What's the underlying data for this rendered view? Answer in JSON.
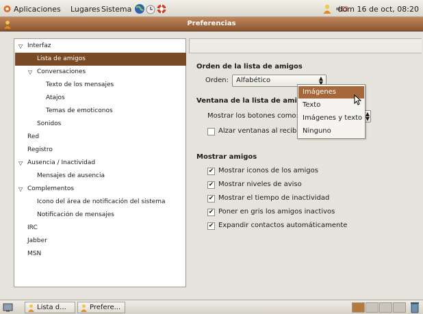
{
  "top_panel": {
    "menus": [
      "Aplicaciones",
      "Lugares",
      "Sistema"
    ],
    "clock": "dom 16 de oct, 08:20"
  },
  "window": {
    "title": "Preferencias"
  },
  "tree": {
    "items": [
      {
        "label": "Interfaz",
        "expanded": true
      },
      {
        "label": "Lista de amigos",
        "selected": true
      },
      {
        "label": "Conversaciones",
        "expanded": true
      },
      {
        "label": "Texto de los mensajes"
      },
      {
        "label": "Atajos"
      },
      {
        "label": "Temas de emoticonos"
      },
      {
        "label": "Sonidos"
      },
      {
        "label": "Red"
      },
      {
        "label": "Registro"
      },
      {
        "label": "Ausencia / Inactividad",
        "expanded": true
      },
      {
        "label": "Mensajes de ausencia"
      },
      {
        "label": "Complementos",
        "expanded": true
      },
      {
        "label": "Icono del área de notificación del sistema"
      },
      {
        "label": "Notificación de mensajes"
      },
      {
        "label": "IRC"
      },
      {
        "label": "Jabber"
      },
      {
        "label": "MSN"
      }
    ]
  },
  "order_section": {
    "title": "Orden de la lista de amigos",
    "order_label": "Orden:",
    "order_value": "Alfabético"
  },
  "window_section": {
    "title": "Ventana de la lista de amic",
    "buttons_label": "Mostrar los botones como:",
    "raise_label": "Alzar ventanas al recibir",
    "raise_checked": false
  },
  "dropdown": {
    "options": [
      "Imágenes",
      "Texto",
      "Imágenes y texto",
      "Ninguno"
    ],
    "highlighted": 0
  },
  "show_section": {
    "title": "Mostrar amigos",
    "options": [
      {
        "label": "Mostrar iconos de los amigos",
        "checked": true
      },
      {
        "label": "Mostrar niveles de aviso",
        "checked": true
      },
      {
        "label": "Mostrar el tiempo de inactividad",
        "checked": true
      },
      {
        "label": "Poner en gris los amigos inactivos",
        "checked": true
      },
      {
        "label": "Expandir contactos automáticamente",
        "checked": true
      }
    ]
  },
  "taskbar": {
    "tasks": [
      "Lista d...",
      "Prefere..."
    ]
  },
  "colors": {
    "accent": "#7a4a24",
    "titlebar": "#a36a40",
    "highlight": "#a6683a"
  }
}
